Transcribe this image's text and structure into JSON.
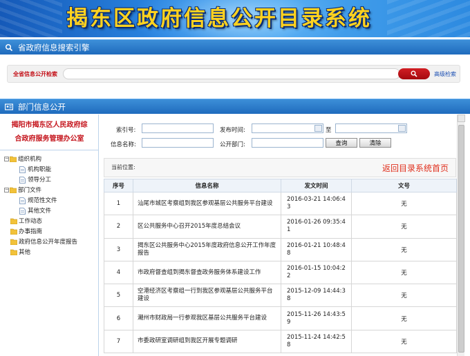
{
  "banner": {
    "title": "揭东区政府信息公开目录系统"
  },
  "search_section": {
    "title": "省政府信息搜索引擎",
    "label": "全省信息公开检索",
    "input_value": "",
    "advanced_link": "高级检索"
  },
  "dept_section": {
    "title": "部门信息公开"
  },
  "department": {
    "name_line1": "揭阳市揭东区人民政府综",
    "name_line2": "合政府服务管理办公室"
  },
  "tree": {
    "org": "组织机构",
    "org_children": [
      "机构职能",
      "领导分工"
    ],
    "docs": "部门文件",
    "docs_children": [
      "规范性文件",
      "其他文件"
    ],
    "others": [
      "工作动态",
      "办事指南",
      "政府信息公开年度报告",
      "其他"
    ]
  },
  "filter": {
    "index_label": "索引号:",
    "date_label": "发布时间:",
    "date_to": "至",
    "name_label": "信息名称:",
    "dept_label": "公开部门:",
    "query_btn": "查询",
    "clear_btn": "清除"
  },
  "location": {
    "label": "当前位置:",
    "back_link": "返回目录系统首页"
  },
  "table": {
    "headers": [
      "序号",
      "信息名称",
      "发文时间",
      "文号"
    ],
    "rows": [
      {
        "idx": "1",
        "name": "汕尾市城区考察组到我区参观基层公共服务平台建设",
        "date": "2016-03-21 14:06:43",
        "doc": "无"
      },
      {
        "idx": "2",
        "name": "区公共服务中心召开2015年度总结会议",
        "date": "2016-01-26 09:35:41",
        "doc": "无"
      },
      {
        "idx": "3",
        "name": "揭东区公共服务中心2015年度政府信息公开工作年度报告",
        "date": "2016-01-21 10:48:48",
        "doc": "无"
      },
      {
        "idx": "4",
        "name": "市政府督查组到揭东督查政务服务体系建设工作",
        "date": "2016-01-15 10:04:22",
        "doc": "无"
      },
      {
        "idx": "5",
        "name": "空港经济区考察组一行到我区参观基层公共服务平台建设",
        "date": "2015-12-09 14:44:38",
        "doc": "无"
      },
      {
        "idx": "6",
        "name": "潮州市财政局一行参观我区基层公共服务平台建设",
        "date": "2015-11-26 14:43:59",
        "doc": "无"
      },
      {
        "idx": "7",
        "name": "市委政研室调研组到我区开展专题调研",
        "date": "2015-11-24 14:42:58",
        "doc": "无"
      }
    ]
  },
  "colors": {
    "accent_red": "#c4121a",
    "header_blue": "#1f6bbd",
    "banner_text": "#ffd21f",
    "back_link": "#e0301e"
  }
}
